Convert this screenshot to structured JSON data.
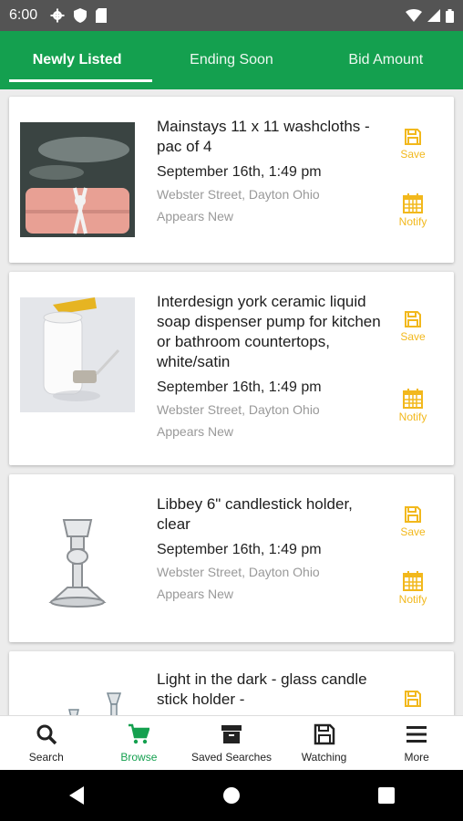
{
  "status_bar": {
    "time": "6:00"
  },
  "tabs": [
    {
      "label": "Newly Listed",
      "active": true
    },
    {
      "label": "Ending Soon",
      "active": false
    },
    {
      "label": "Bid Amount",
      "active": false
    }
  ],
  "colors": {
    "brand_green": "#14a04f",
    "accent_yellow": "#f2b81c"
  },
  "listings": [
    {
      "title": "Mainstays 11 x 11 washcloths - pac of 4",
      "date": "September 16th, 1:49 pm",
      "location": "Webster Street, Dayton Ohio",
      "condition": "Appears New",
      "save_label": "Save",
      "notify_label": "Notify"
    },
    {
      "title": "Interdesign york ceramic liquid soap dispenser pump for kitchen or bathroom countertops, white/satin",
      "date": "September 16th, 1:49 pm",
      "location": "Webster Street, Dayton Ohio",
      "condition": "Appears New",
      "save_label": "Save",
      "notify_label": "Notify"
    },
    {
      "title": "Libbey 6\" candlestick holder, clear",
      "date": "September 16th, 1:49 pm",
      "location": "Webster Street, Dayton Ohio",
      "condition": "Appears New",
      "save_label": "Save",
      "notify_label": "Notify"
    },
    {
      "title": "Light in the dark - glass candle stick holder -"
    }
  ],
  "bottom_nav": [
    {
      "label": "Search",
      "icon": "search-icon",
      "active": false
    },
    {
      "label": "Browse",
      "icon": "cart-icon",
      "active": true
    },
    {
      "label": "Saved Searches",
      "icon": "archive-icon",
      "active": false
    },
    {
      "label": "Watching",
      "icon": "floppy-icon",
      "active": false
    },
    {
      "label": "More",
      "icon": "menu-icon",
      "active": false
    }
  ]
}
